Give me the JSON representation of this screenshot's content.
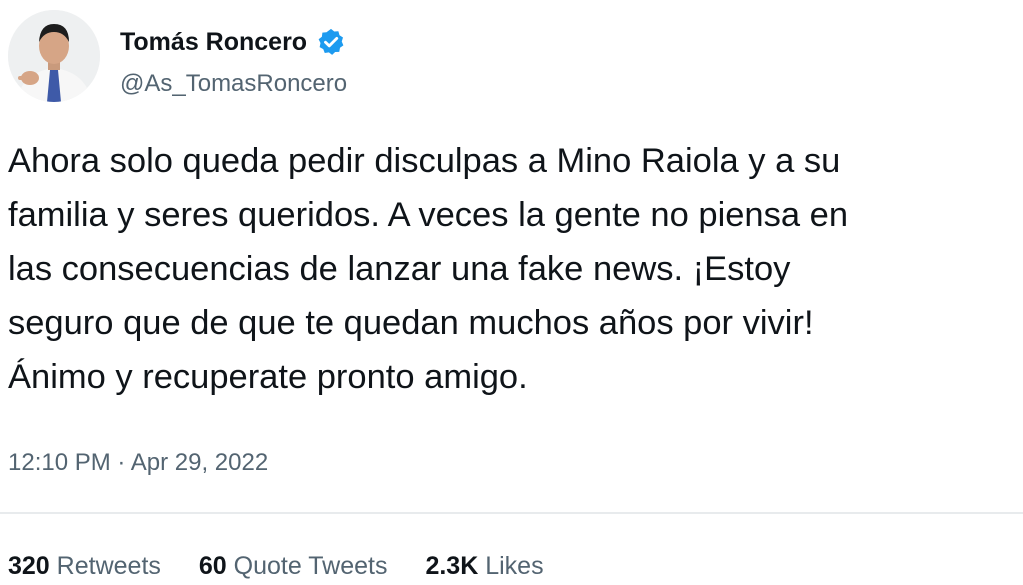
{
  "author": {
    "display_name": "Tomás Roncero",
    "handle": "@As_TomasRoncero",
    "verified": true,
    "verified_color": "#1d9bf0",
    "avatar_icon": "profile-photo"
  },
  "tweet": {
    "text_lines": [
      "Ahora solo queda pedir disculpas a Mino Raiola y a su",
      "familia y seres queridos. A veces la gente no piensa en",
      "las consecuencias de lanzar una fake news. ¡Estoy",
      "seguro que de que te quedan muchos años por vivir!",
      "Ánimo y recuperate pronto amigo."
    ],
    "timestamp": "12:10 PM · Apr 29, 2022"
  },
  "stats": [
    {
      "count": "320",
      "label": "Retweets"
    },
    {
      "count": "60",
      "label": "Quote Tweets"
    },
    {
      "count": "2.3K",
      "label": "Likes"
    }
  ]
}
